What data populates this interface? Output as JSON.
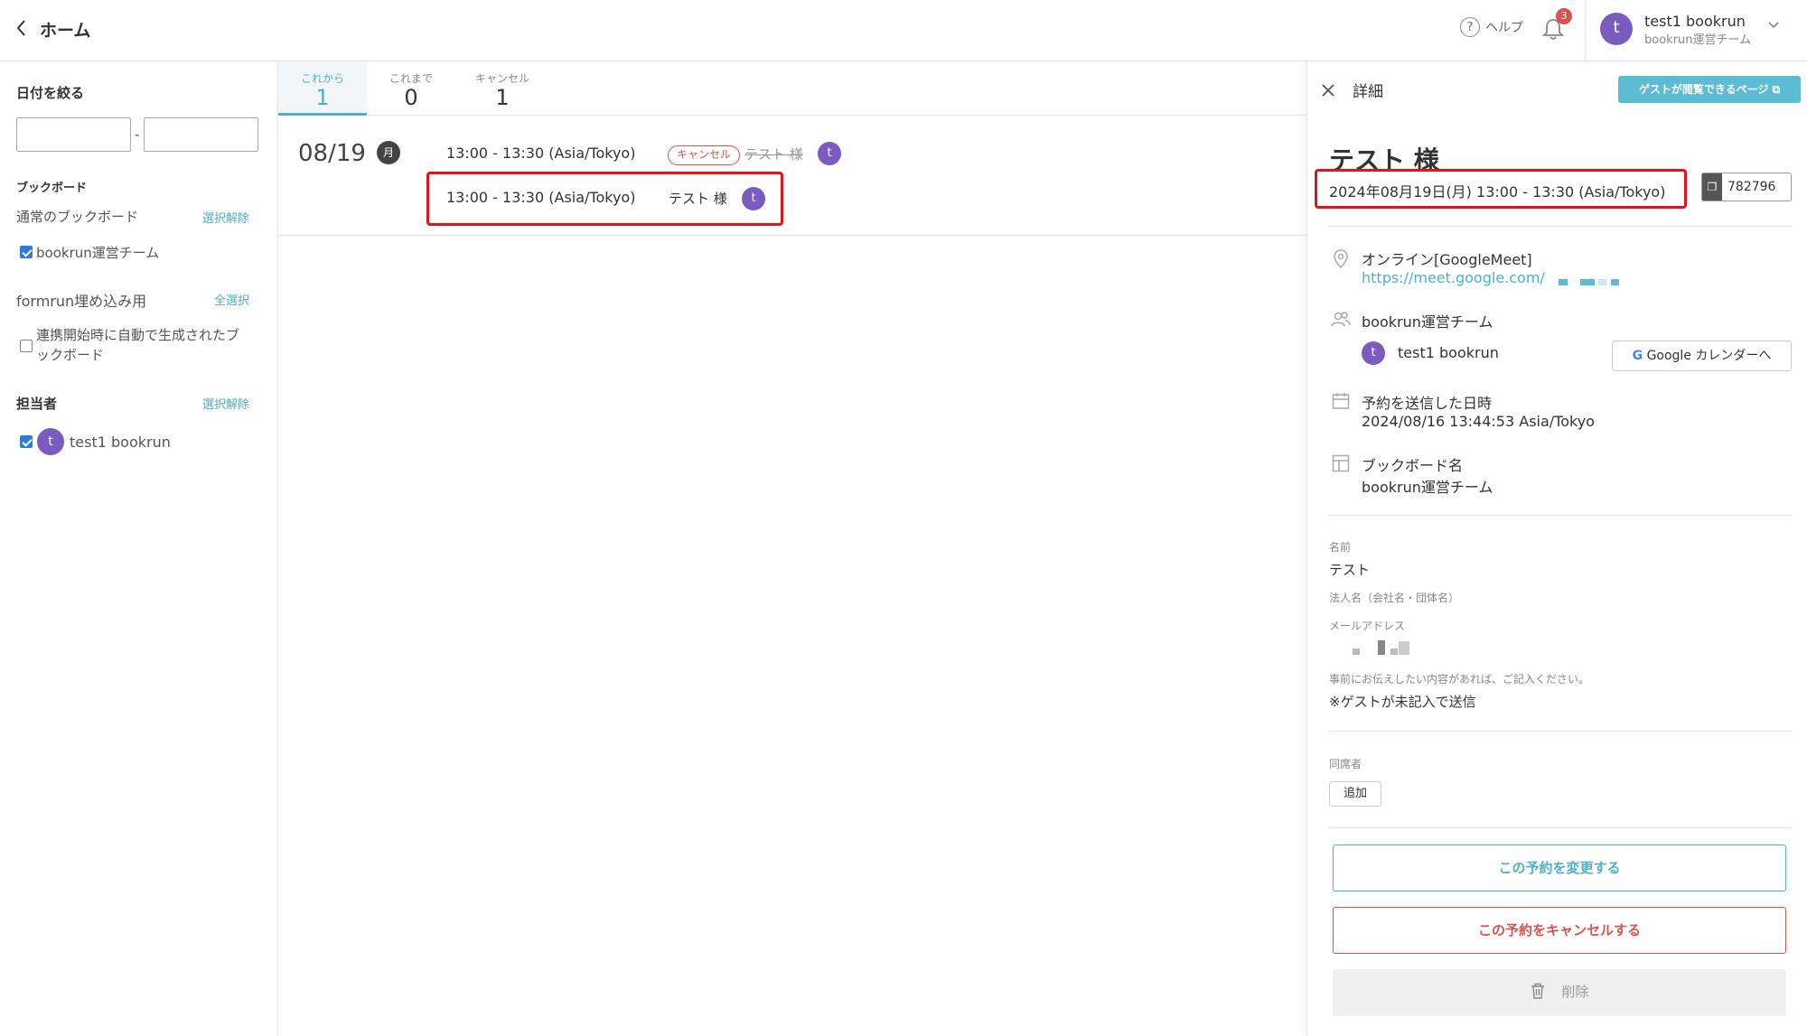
{
  "header": {
    "back_icon": "chevron-left",
    "title": "ホーム",
    "help_label": "ヘルプ",
    "notification_count": "3",
    "user": {
      "avatar_letter": "t",
      "name": "test1 bookrun",
      "team": "bookrun運営チーム"
    }
  },
  "sidebar": {
    "date_filter_title": "日付を絞る",
    "date_separator": "-",
    "date_from": "",
    "date_to": "",
    "bookboard_title": "ブックボード",
    "normal_bookboard_label": "通常のブックボード",
    "normal_deselect": "選択解除",
    "normal_items": [
      {
        "label": "bookrun運営チーム",
        "checked": true
      }
    ],
    "formrun_label": "formrun埋め込み用",
    "formrun_select_all": "全選択",
    "formrun_items": [
      {
        "label_line1": "連携開始時に自動で生成されたブ",
        "label_line2": "ックボード",
        "checked": false
      }
    ],
    "assignee_title": "担当者",
    "assignee_deselect": "選択解除",
    "assignees": [
      {
        "avatar_letter": "t",
        "name": "test1 bookrun",
        "checked": true
      }
    ]
  },
  "tabs": [
    {
      "label": "これから",
      "count": "1",
      "active": true
    },
    {
      "label": "これまで",
      "count": "0",
      "active": false
    },
    {
      "label": "キャンセル",
      "count": "1",
      "active": false
    }
  ],
  "reservations": {
    "date": "08/19",
    "weekday": "月",
    "rows": [
      {
        "time": "13:00 - 13:30 (Asia/Tokyo)",
        "status": "キャンセル",
        "guest": "テスト 様",
        "avatar_letter": "t",
        "cancelled": true
      },
      {
        "time": "13:00 - 13:30 (Asia/Tokyo)",
        "status": "",
        "guest": "テスト 様",
        "avatar_letter": "t",
        "cancelled": false
      }
    ]
  },
  "detail": {
    "title": "詳細",
    "guest_page_button": "ゲストが閲覧できるページ",
    "name": "テスト 様",
    "datetime": "2024年08月19日(月) 13:00 - 13:30 (Asia/Tokyo)",
    "reservation_id": "782796",
    "location_label": "オンライン[GoogleMeet]",
    "location_link": "https://meet.google.com/",
    "team": "bookrun運営チーム",
    "assignee_avatar": "t",
    "assignee_name": "test1 bookrun",
    "gcal_g": "G",
    "gcal_button": "Google カレンダーへ",
    "sent_label": "予約を送信した日時",
    "sent_value": "2024/08/16 13:44:53 Asia/Tokyo",
    "bookboard_label": "ブックボード名",
    "bookboard_value": "bookrun運営チーム",
    "fields": {
      "name_label": "名前",
      "name_value": "テスト",
      "company_label": "法人名（会社名・団体名）",
      "email_label": "メールアドレス",
      "note_label": "事前にお伝えしたい内容があれば、ご記入ください。",
      "note_value": "※ゲストが未記入で送信"
    },
    "attendees_label": "同席者",
    "add_button": "追加",
    "change_button": "この予約を変更する",
    "cancel_button": "この予約をキャンセルする",
    "delete_button": "削除"
  },
  "colors": {
    "accent": "#4fb0c6",
    "danger": "#d9534f",
    "avatar": "#7a5cc0",
    "highlight": "#e0141a"
  }
}
